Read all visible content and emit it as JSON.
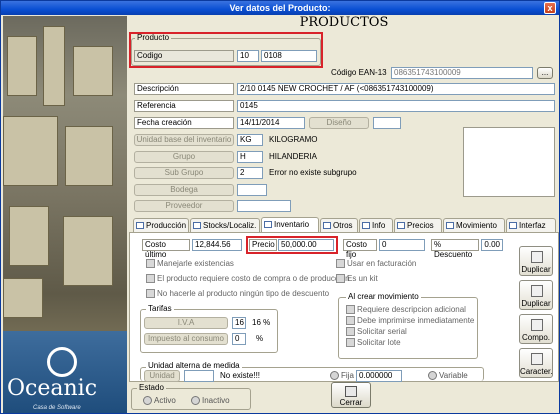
{
  "window": {
    "title": "Ver datos del Producto:",
    "close": "x"
  },
  "branding": {
    "name": "Oceanic",
    "tagline": "Casa de Software"
  },
  "header": "PRODUCTOS",
  "producto": {
    "legend": "Producto",
    "codigo_label": "Codigo",
    "codigo_prefix": "10",
    "codigo_value": "0108",
    "ean_label": "Código EAN-13",
    "ean_value": "086351743100009",
    "ean_btn": "..."
  },
  "fields": {
    "descripcion_label": "Descripción",
    "descripcion_value": "2/10 0145  NEW CROCHET / AF        (<086351743100009)",
    "referencia_label": "Referencia",
    "referencia_value": "0145",
    "fecha_label": "Fecha creación",
    "fecha_value": "14/11/2014",
    "diseno_label": "Diseño",
    "unidad_label": "Unidad base del inventario",
    "unidad_code": "KG",
    "unidad_name": "KILOGRAMO",
    "grupo_label": "Grupo",
    "grupo_code": "H",
    "grupo_name": "HILANDERIA",
    "subgrupo_label": "Sub Grupo",
    "subgrupo_code": "2",
    "subgrupo_name": "Error no existe subgrupo",
    "bodega_label": "Bodega",
    "proveedor_label": "Proveedor"
  },
  "tabs": [
    {
      "label": "Producción"
    },
    {
      "label": "Stocks/Localiz."
    },
    {
      "label": "Inventario"
    },
    {
      "label": "Otros"
    },
    {
      "label": "Info"
    },
    {
      "label": "Precios"
    },
    {
      "label": "Movimiento"
    },
    {
      "label": "Interfaz"
    }
  ],
  "inventario": {
    "costo_ultimo_label": "Costo último",
    "costo_ultimo_value": "12,844.56",
    "precio_label": "Precio",
    "precio_value": "50,000.00",
    "costo_fijo_label": "Costo fijo",
    "costo_fijo_value": "0",
    "descuento_label": "% Descuento",
    "descuento_value": "0.00",
    "chk_existencias": "Manejarle existencias",
    "chk_costo": "El producto requiere costo de compra o de producción",
    "chk_descuento": "No hacerle al producto ningún tipo de descuento",
    "chk_facturacion": "Usar en facturación",
    "chk_kit": "Es un kit",
    "tarifas_legend": "Tarifas",
    "iva_label": "I.V.A",
    "iva_value": "16",
    "iva_pct": "16 %",
    "consumo_label": "Impuesto al consumo",
    "consumo_value": "0",
    "consumo_pct": "%",
    "movimiento_legend": "Al crear movimiento",
    "mov_1": "Requiere descripcion adicional",
    "mov_2": "Debe imprimirse inmediatamente",
    "mov_3": "Solicitar serial",
    "mov_4": "Solicitar lote",
    "alterna_legend": "Unidad alterna de medida",
    "alterna_btn": "Unidad",
    "alterna_msg": "No existe!!!",
    "fija_label": "Fija",
    "fija_value": "0.000000",
    "variable_label": "Variable"
  },
  "side_buttons": [
    "Duplicar",
    "Duplicar",
    "Compo.",
    "Caracter."
  ],
  "estado": {
    "legend": "Estado",
    "activo": "Activo",
    "inactivo": "Inactivo"
  },
  "cerrar": "Cerrar"
}
